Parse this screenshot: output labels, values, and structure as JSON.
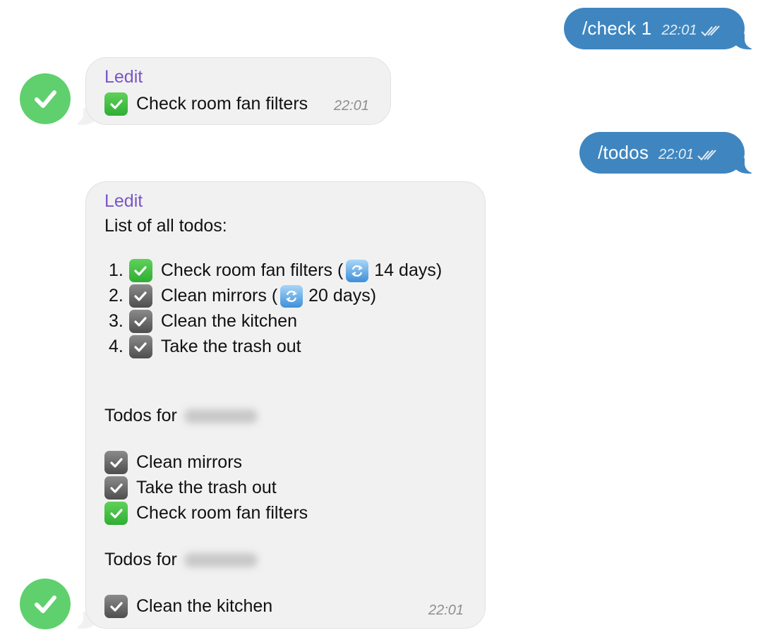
{
  "messages": {
    "out1": {
      "text": "/check 1",
      "time": "22:01"
    },
    "in1": {
      "sender": "Ledit",
      "text": "Check room fan filters",
      "time": "22:01"
    },
    "out2": {
      "text": "/todos",
      "time": "22:01"
    },
    "in2": {
      "sender": "Ledit",
      "header": "List of all todos:",
      "todos": [
        {
          "num": "1.",
          "text": "Check room fan filters (",
          "interval": "14 days)",
          "icon": "green-check-emoji"
        },
        {
          "num": "2.",
          "text": "Clean mirrors (",
          "interval": "20 days)",
          "icon": "gray-check-emoji"
        },
        {
          "num": "3.",
          "text": "Clean the kitchen",
          "icon": "gray-check-emoji"
        },
        {
          "num": "4.",
          "text": "Take the trash out",
          "icon": "gray-check-emoji"
        }
      ],
      "section1": {
        "title": "Todos for",
        "items": [
          "Clean mirrors",
          "Take the trash out",
          "Check room fan filters"
        ]
      },
      "section2": {
        "title": "Todos for",
        "items": [
          "Clean the kitchen"
        ]
      },
      "time": "22:01"
    }
  },
  "colors": {
    "outgoing_bubble": "#3f86c0",
    "incoming_bubble": "#f1f1f1",
    "sender_name": "#7a55c9",
    "avatar": "#5fd06d"
  }
}
